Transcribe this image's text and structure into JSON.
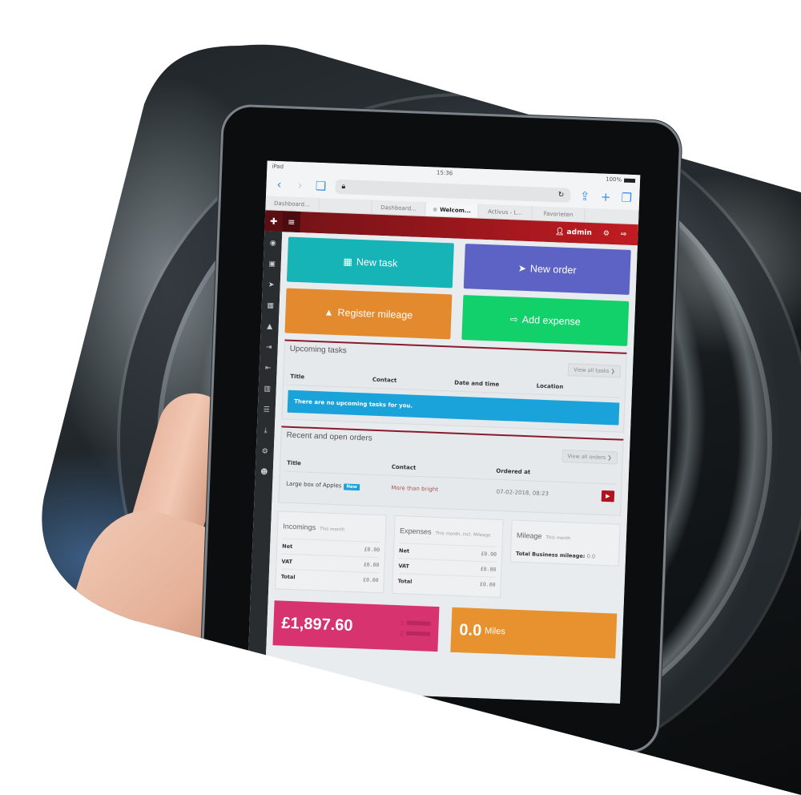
{
  "device": {
    "status_bar": {
      "left": "iPad",
      "time": "15:36",
      "battery": "100%"
    },
    "browser": {
      "back_icon": "chevron-left-icon",
      "forward_icon": "chevron-right-icon",
      "bookmarks_icon": "book-icon",
      "lock_icon": "lock-icon",
      "reload_icon": "reload-icon",
      "share_icon": "share-icon",
      "new_tab_icon": "plus-icon",
      "tabs_icon": "tabs-icon",
      "tabs": [
        {
          "label": "Dashboard...",
          "active": false
        },
        {
          "label": "",
          "active": false
        },
        {
          "label": "Dashboard...",
          "active": false
        },
        {
          "label": "Welcom...",
          "active": true
        },
        {
          "label": "Activus - L...",
          "active": false
        },
        {
          "label": "Favorieten",
          "active": false
        },
        {
          "label": "",
          "active": false
        }
      ]
    }
  },
  "app": {
    "header": {
      "user_label": "admin",
      "colors": {
        "dark": "#6e1216",
        "accent": "#c01c22"
      }
    },
    "sidebar": {
      "items": [
        {
          "name": "dashboard",
          "glyph": "◉"
        },
        {
          "name": "contacts",
          "glyph": "▣"
        },
        {
          "name": "orders",
          "glyph": "➤"
        },
        {
          "name": "calendar",
          "glyph": "▦"
        },
        {
          "name": "mileage",
          "glyph": "▲"
        },
        {
          "name": "incomings",
          "glyph": "⇥"
        },
        {
          "name": "expenses",
          "glyph": "⇤"
        },
        {
          "name": "reports",
          "glyph": "▥"
        },
        {
          "name": "list",
          "glyph": "☰"
        },
        {
          "name": "download",
          "glyph": "⤓"
        },
        {
          "name": "settings",
          "glyph": "⚙"
        },
        {
          "name": "users",
          "glyph": "☻"
        }
      ]
    },
    "quick_actions": [
      {
        "label": "New task",
        "icon": "calendar-icon",
        "glyph": "▦",
        "color": "#16b3b7"
      },
      {
        "label": "New order",
        "icon": "paper-plane-icon",
        "glyph": "➤",
        "color": "#5d63c4"
      },
      {
        "label": "Register mileage",
        "icon": "road-icon",
        "glyph": "▲",
        "color": "#e38a2f"
      },
      {
        "label": "Add expense",
        "icon": "sign-out-icon",
        "glyph": "⇨",
        "color": "#12d16a"
      }
    ],
    "upcoming_tasks": {
      "title": "Upcoming tasks",
      "view_all": "View all tasks ❯",
      "columns": [
        "Title",
        "Contact",
        "Date and time",
        "Location"
      ],
      "empty_message": "There are no upcoming tasks for you."
    },
    "recent_orders": {
      "title": "Recent and open orders",
      "view_all": "View all orders ❯",
      "columns": [
        "Title",
        "Contact",
        "Ordered at"
      ],
      "rows": [
        {
          "title": "Large box of Apples",
          "badge": "New",
          "contact": "More than bright",
          "ordered_at": "07-02-2018, 08:23"
        }
      ]
    },
    "incomings": {
      "title": "Incomings",
      "subtitle": "This month",
      "rows": [
        {
          "label": "Net",
          "value": "£0.00"
        },
        {
          "label": "VAT",
          "value": "£0.00"
        },
        {
          "label": "Total",
          "value": "£0.00"
        }
      ]
    },
    "expenses": {
      "title": "Expenses",
      "subtitle": "This month, incl. Mileage",
      "rows": [
        {
          "label": "Net",
          "value": "£0.00"
        },
        {
          "label": "VAT",
          "value": "£0.00"
        },
        {
          "label": "Total",
          "value": "£0.00"
        }
      ]
    },
    "mileage": {
      "title": "Mileage",
      "subtitle": "This month",
      "label": "Total Business mileage:",
      "value": "0.0"
    },
    "summary_cards": [
      {
        "amount": "£1,897.60",
        "unit": "",
        "color": "#d6336f",
        "list_items": [
          "1",
          "2"
        ]
      },
      {
        "amount": "0.0",
        "unit": "Miles",
        "color": "#e8912f"
      }
    ]
  }
}
